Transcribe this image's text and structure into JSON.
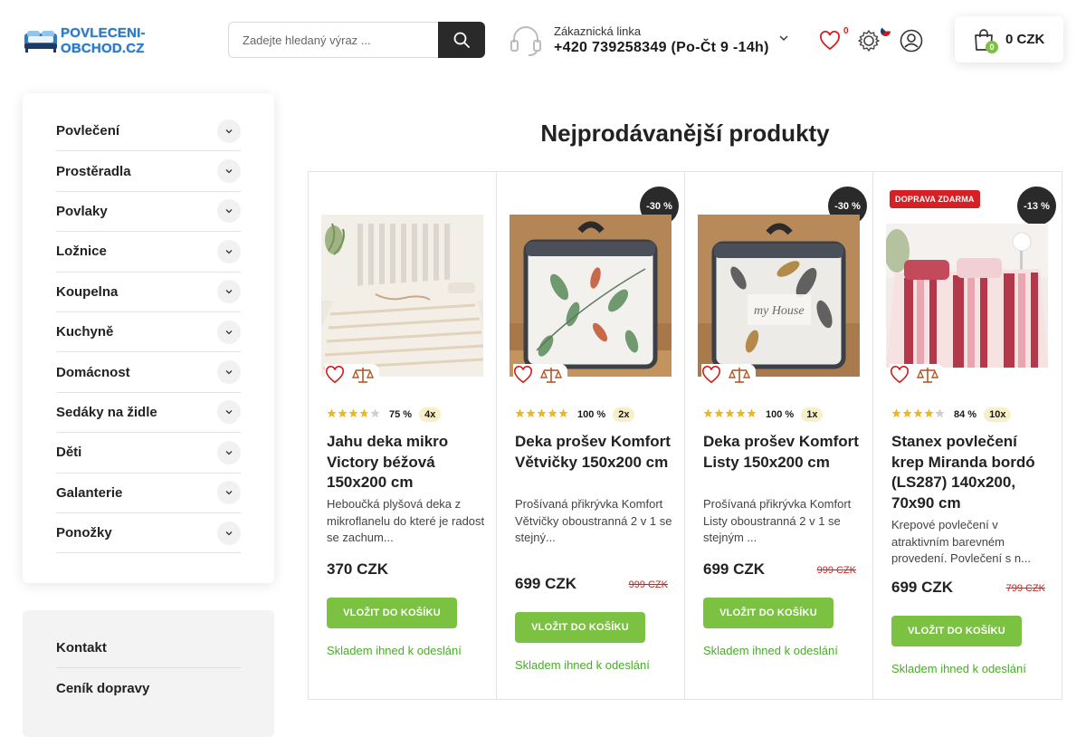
{
  "header": {
    "logo_text": "POVLECENI-OBCHOD.CZ",
    "search_placeholder": "Zadejte hledaný výraz ...",
    "hotline_label": "Zákaznická linka",
    "hotline_phone": "+420 739258349 (Po-Čt 9 -14h)",
    "wishlist_count": "0",
    "cart_count": "0",
    "cart_total": "0 CZK",
    "icons": [
      "headset-icon",
      "chevron-down-icon",
      "heart-icon",
      "settings-icon",
      "czech-flag-icon",
      "user-icon",
      "shopping-bag-icon",
      "search-icon"
    ]
  },
  "sidebar": {
    "categories": [
      "Povlečení",
      "Prostěradla",
      "Povlaky",
      "Ložnice",
      "Koupelna",
      "Kuchyně",
      "Domácnost",
      "Sedáky na židle",
      "Děti",
      "Galanterie",
      "Ponožky"
    ],
    "links": [
      "Kontakt",
      "Ceník dopravy"
    ]
  },
  "main": {
    "section_title": "Nejprodávanější produkty",
    "buy_label": "VLOŽIT DO KOŠÍKU",
    "stock_label": "Skladem ihned k odeslání",
    "products": [
      {
        "name": "Jahu deka mikro Victory béžová 150x200 cm",
        "description": "Heboučká plyšová deka z mikroflanelu do které je radost se zachum...",
        "rating_pct": "75 %",
        "rating_stars": 3.75,
        "rating_count": "4x",
        "price": "370 CZK",
        "old_price": "",
        "discount": "",
        "ship_badge": ""
      },
      {
        "name": "Deka prošev Komfort Větvičky 150x200 cm",
        "description": "Prošívaná přikrývka Komfort Větvičky oboustranná 2 v 1 se stejný...",
        "rating_pct": "100 %",
        "rating_stars": 5,
        "rating_count": "2x",
        "price": "699 CZK",
        "old_price": "999 CZK",
        "discount": "-30 %",
        "ship_badge": ""
      },
      {
        "name": "Deka prošev Komfort Listy 150x200 cm",
        "description": "Prošívaná přikrývka Komfort Listy oboustranná 2 v 1 se stejným ...",
        "rating_pct": "100 %",
        "rating_stars": 5,
        "rating_count": "1x",
        "price": "699 CZK",
        "old_price": "999 CZK",
        "discount": "-30 %",
        "ship_badge": ""
      },
      {
        "name": "Stanex povlečení krep Miranda bordó (LS287) 140x200, 70x90 cm",
        "description": "Krepové povlečení v atraktivním barevném provedení. Povlečení s n...",
        "rating_pct": "84 %",
        "rating_stars": 4.2,
        "rating_count": "10x",
        "price": "699 CZK",
        "old_price": "799 CZK",
        "discount": "-13 %",
        "ship_badge": "DOPRAVA ZDARMA"
      }
    ]
  },
  "colors": {
    "accent_green": "#7cc242",
    "dark": "#2a2a2a",
    "sale_red": "#d21f1f",
    "star_gold": "#e8b92a"
  }
}
